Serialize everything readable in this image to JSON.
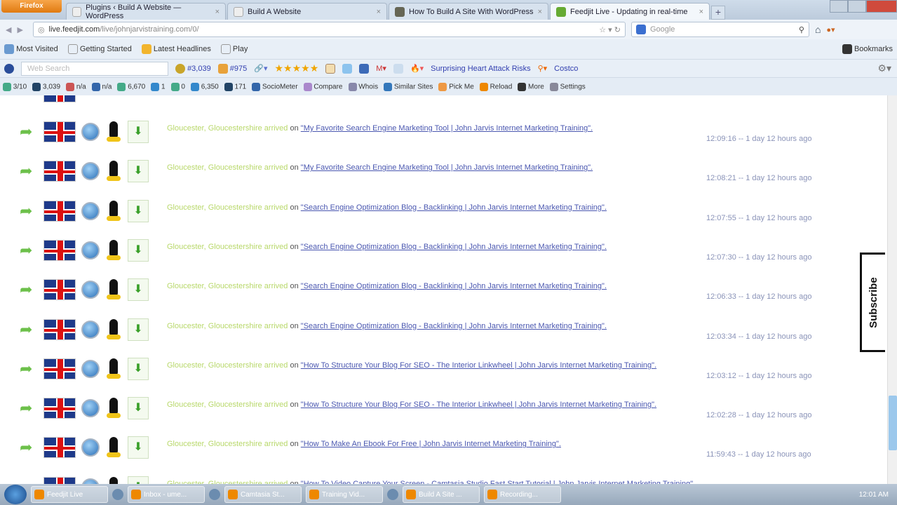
{
  "browser": {
    "menu_button": "Firefox",
    "tabs": [
      {
        "label": "Plugins ‹ Build A Website — WordPress"
      },
      {
        "label": "Build A Website"
      },
      {
        "label": "How To Build A Site With WordPress"
      },
      {
        "label": "Feedjit Live - Updating in real-time",
        "active": true
      }
    ],
    "url_host": "live.feedjit.com",
    "url_rest": "/live/johnjarvistraining.com/0/",
    "search_placeholder": "Google"
  },
  "bookmarks": [
    "Most Visited",
    "Getting Started",
    "Latest Headlines",
    "Play"
  ],
  "bookmarks_menu": "Bookmarks",
  "toolbar1": {
    "search_placeholder": "Web Search",
    "rank1": "#3,039",
    "rank2": "#975",
    "stars": "★★★★★",
    "link1": "Surprising Heart Attack Risks",
    "link2": "Costco"
  },
  "toolbar2": {
    "items": [
      "3/10",
      "3,039",
      "n/a",
      "n/a",
      "6,670",
      "1",
      "0",
      "6,350",
      "171",
      "SocioMeter",
      "Compare",
      "Whois",
      "Similar Sites",
      "Pick Me",
      "Reload",
      "More",
      "Settings"
    ]
  },
  "feed": {
    "location": "Gloucester, Gloucestershire arrived",
    "on": "on",
    "rows": [
      {
        "title": "\"My Favorite Search Engine Marketing Tool | John Jarvis Internet Marketing Training\".",
        "time": "12:09:16 -- 1 day 12 hours ago"
      },
      {
        "title": "\"My Favorite Search Engine Marketing Tool | John Jarvis Internet Marketing Training\".",
        "time": "12:08:21 -- 1 day 12 hours ago"
      },
      {
        "title": "\"Search Engine Optimization Blog - Backlinking | John Jarvis Internet Marketing Training\".",
        "time": "12:07:55 -- 1 day 12 hours ago"
      },
      {
        "title": "\"Search Engine Optimization Blog - Backlinking | John Jarvis Internet Marketing Training\".",
        "time": "12:07:30 -- 1 day 12 hours ago"
      },
      {
        "title": "\"Search Engine Optimization Blog - Backlinking | John Jarvis Internet Marketing Training\".",
        "time": "12:06:33 -- 1 day 12 hours ago"
      },
      {
        "title": "\"Search Engine Optimization Blog - Backlinking | John Jarvis Internet Marketing Training\".",
        "time": "12:03:34 -- 1 day 12 hours ago"
      },
      {
        "title": "\"How To Structure Your Blog For SEO - The Interior Linkwheel | John Jarvis Internet Marketing Training\".",
        "time": "12:03:12 -- 1 day 12 hours ago"
      },
      {
        "title": "\"How To Structure Your Blog For SEO - The Interior Linkwheel | John Jarvis Internet Marketing Training\".",
        "time": "12:02:28 -- 1 day 12 hours ago"
      },
      {
        "title": "\"How To Make An Ebook For Free | John Jarvis Internet Marketing Training\".",
        "time": "11:59:43 -- 1 day 12 hours ago"
      },
      {
        "title": "\"How To Video Capture Your Screen - Camtasia Studio Fast Start Tutorial | John Jarvis Internet Marketing Training\".",
        "time": ""
      }
    ]
  },
  "subscribe": "Subscribe",
  "taskbar": {
    "buttons": [
      "Feedjit Live",
      "Inbox - ume...",
      "Camtasia St...",
      "Training Vid...",
      "Build A Site ...",
      "Recording..."
    ],
    "clock": "12:01 AM"
  }
}
